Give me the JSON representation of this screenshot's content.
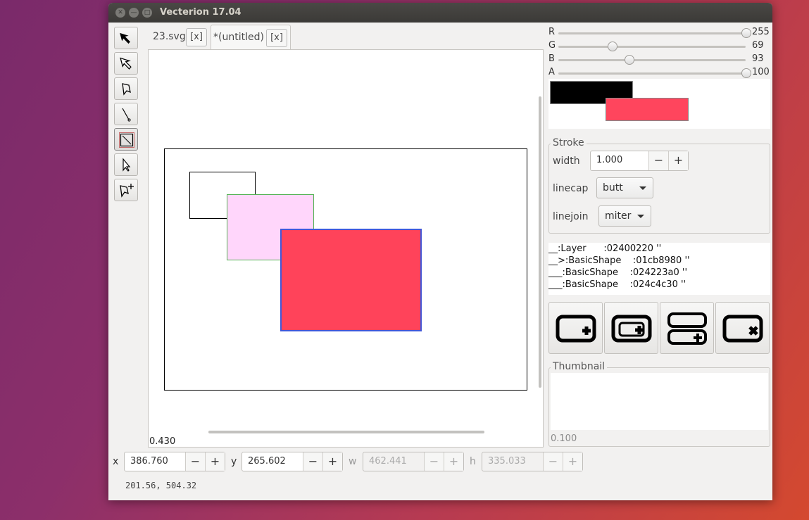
{
  "window": {
    "title": "Vecterion 17.04"
  },
  "tabs": [
    {
      "label": "23.svg",
      "close": "[x]"
    },
    {
      "label": "*(untitled)",
      "close": "[x]"
    }
  ],
  "tools": [
    {
      "icon": "select-arrow-icon"
    },
    {
      "icon": "node-select-icon"
    },
    {
      "icon": "polygon-tool-icon"
    },
    {
      "icon": "line-tool-icon"
    },
    {
      "icon": "rectangle-tool-icon"
    },
    {
      "icon": "pointer-tool-icon"
    },
    {
      "icon": "add-node-tool-icon"
    }
  ],
  "canvas": {
    "zoom": "0.430",
    "colors": {
      "fill_pink": "#ffd6fb",
      "border_green": "#55b355",
      "fill_red": "#ff435a",
      "border_blue": "#4257d7"
    }
  },
  "properties": {
    "x": {
      "label": "x",
      "value": "386.760",
      "minus": "−",
      "plus": "+"
    },
    "y": {
      "label": "y",
      "value": "265.602",
      "minus": "−",
      "plus": "+"
    },
    "w": {
      "label": "w",
      "value": "462.441",
      "minus": "−",
      "plus": "+"
    },
    "h": {
      "label": "h",
      "value": "335.033",
      "minus": "−",
      "plus": "+"
    }
  },
  "status": {
    "coords": "201.56, 504.32"
  },
  "color_sliders": [
    {
      "label": "R",
      "value": "255"
    },
    {
      "label": "G",
      "value": "69"
    },
    {
      "label": "B",
      "value": "93"
    },
    {
      "label": "A",
      "value": "100"
    }
  ],
  "swatches": {
    "stroke": "#000000",
    "fill": "#ff455d"
  },
  "stroke": {
    "title": "Stroke",
    "width_label": "width",
    "width_value": "1.000",
    "minus": "−",
    "plus": "+",
    "linecap_label": "linecap",
    "linecap_value": "butt",
    "linejoin_label": "linejoin",
    "linejoin_value": "miter"
  },
  "layers_tree": [
    "__:Layer      :02400220 ''",
    "__>:BasicShape    :01cb8980 ''",
    "___:BasicShape    :024223a0 ''",
    "___:BasicShape    :024c4c30 ''"
  ],
  "layer_buttons": [
    {
      "icon": "add-layer-icon"
    },
    {
      "icon": "add-child-layer-icon"
    },
    {
      "icon": "add-sibling-layer-icon"
    },
    {
      "icon": "delete-layer-icon"
    }
  ],
  "thumbnail": {
    "title": "Thumbnail",
    "value": "0.100"
  }
}
